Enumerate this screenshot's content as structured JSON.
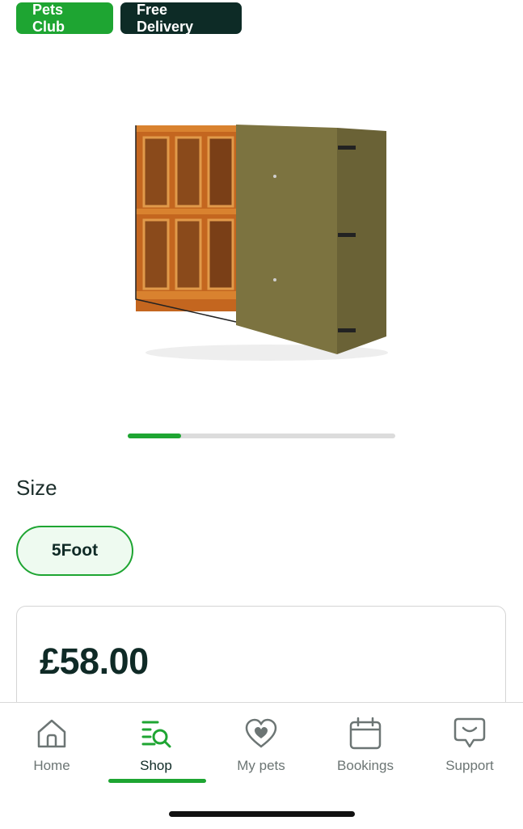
{
  "badges": {
    "pets_club": "Pets Club",
    "free_delivery": "Free Delivery"
  },
  "product": {
    "image_icon": "hutch-cover-image",
    "carousel_progress": 0.2
  },
  "size": {
    "label": "Size",
    "selected_option": "5Foot"
  },
  "price": {
    "amount": "£58.00"
  },
  "nav": {
    "items": [
      {
        "label": "Home",
        "icon": "home-icon",
        "active": false
      },
      {
        "label": "Shop",
        "icon": "shop-search-icon",
        "active": true
      },
      {
        "label": "My pets",
        "icon": "heart-icon",
        "active": false
      },
      {
        "label": "Bookings",
        "icon": "calendar-icon",
        "active": false
      },
      {
        "label": "Support",
        "icon": "chat-support-icon",
        "active": false
      }
    ]
  },
  "colors": {
    "brand_green": "#1ea532",
    "brand_dark": "#0d2b26"
  }
}
